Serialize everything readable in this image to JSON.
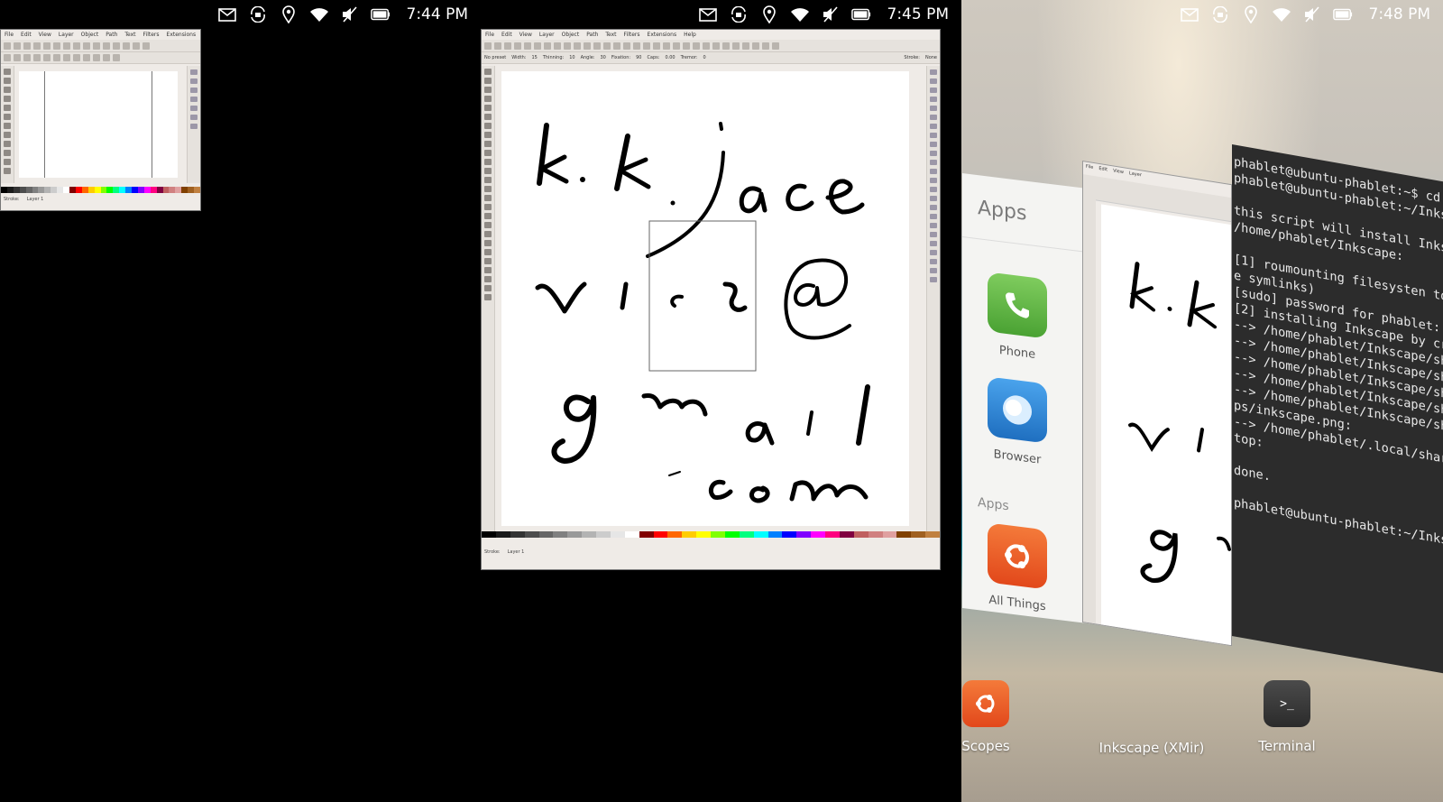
{
  "status_bars": [
    {
      "time": "7:44 PM"
    },
    {
      "time": "7:45 PM"
    },
    {
      "time": "7:48 PM"
    }
  ],
  "status_icons": [
    "mail-icon",
    "rotation-lock-icon",
    "location-icon",
    "wifi-icon",
    "volume-muted-icon",
    "battery-icon"
  ],
  "inkscape": {
    "menu": [
      "File",
      "Edit",
      "View",
      "Layer",
      "Object",
      "Path",
      "Text",
      "Filters",
      "Extensions",
      "Help"
    ],
    "layer_selector": "Layer 1",
    "preset": "No preset",
    "labels": {
      "width": "Width:",
      "thinning": "Thinning:",
      "angle": "Angle:",
      "fixation": "Fixation:",
      "caps": "Caps:",
      "tremor": "Tremor:",
      "stroke": "Stroke:",
      "none": "None"
    },
    "values": {
      "width": "15",
      "thinning": "10",
      "angle": "30",
      "fixation": "90",
      "caps": "0.00",
      "tremor": "0"
    },
    "palette": [
      "#000000",
      "#1a1a1a",
      "#333333",
      "#4d4d4d",
      "#666666",
      "#808080",
      "#999999",
      "#b3b3b3",
      "#cccccc",
      "#e6e6e6",
      "#ffffff",
      "#800000",
      "#ff0000",
      "#ff6600",
      "#ffcc00",
      "#ffff00",
      "#80ff00",
      "#00ff00",
      "#00ff80",
      "#00ffff",
      "#0080ff",
      "#0000ff",
      "#8000ff",
      "#ff00ff",
      "#ff0080",
      "#800040",
      "#c06060",
      "#d08080",
      "#e0a0a0",
      "#804000",
      "#a06020",
      "#c08040"
    ]
  },
  "handwriting_words": [
    "k.k. jace",
    "wicz@",
    "gmail",
    ".com"
  ],
  "spread": {
    "apps_title": "Apps",
    "apps_section": "Apps",
    "apps": [
      {
        "label": "Phone",
        "color": "#5fb344",
        "icon": "phone-icon"
      },
      {
        "label": "Browser",
        "color": "#2f86d5",
        "icon": "browser-icon"
      },
      {
        "label": "All Things",
        "color": "#e95420",
        "icon": "ubuntu-icon"
      }
    ],
    "terminal_lines": [
      "phablet@ubuntu-phablet:~$ cd",
      "phablet@ubuntu-phablet:~/Inks",
      "",
      "this script will install Inks",
      "/home/phablet/Inkscape:",
      "",
      "[1] roumounting filesysten to",
      "e symlinks)",
      "[sudo] password for phablet:",
      "[2] installing Inkscape by cr",
      "--> /home/phablet/Inkscape/sh",
      "--> /home/phablet/Inkscape/sh",
      "--> /home/phablet/Inkscape/sh",
      "--> /home/phablet/Inkscape/sh",
      "--> /home/phablet/Inkscape/sh",
      "ps/inkscape.png:",
      "--> /home/phablet/.local/shar",
      "top:",
      "",
      "done.",
      "",
      "phablet@ubuntu-phablet:~/Inks"
    ],
    "launcher": [
      {
        "label": "Scopes",
        "color": "#e95420"
      },
      {
        "label": "Inkscape (XMir)",
        "color": "transparent"
      },
      {
        "label": "Terminal",
        "color": "#3a3a3a",
        "glyph": ">_"
      }
    ]
  }
}
